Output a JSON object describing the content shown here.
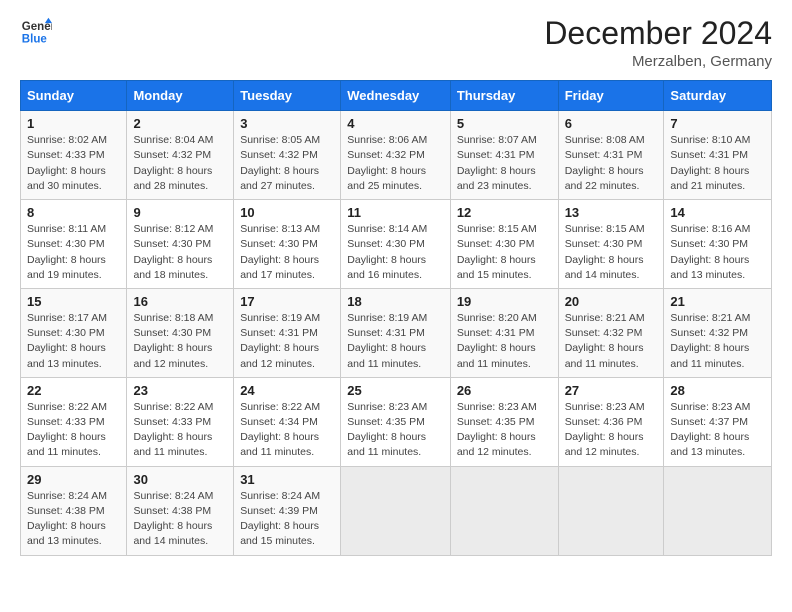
{
  "header": {
    "logo_line1": "General",
    "logo_line2": "Blue",
    "month": "December 2024",
    "location": "Merzalben, Germany"
  },
  "weekdays": [
    "Sunday",
    "Monday",
    "Tuesday",
    "Wednesday",
    "Thursday",
    "Friday",
    "Saturday"
  ],
  "weeks": [
    [
      {
        "day": "1",
        "sunrise": "8:02 AM",
        "sunset": "4:33 PM",
        "daylight": "8 hours and 30 minutes."
      },
      {
        "day": "2",
        "sunrise": "8:04 AM",
        "sunset": "4:32 PM",
        "daylight": "8 hours and 28 minutes."
      },
      {
        "day": "3",
        "sunrise": "8:05 AM",
        "sunset": "4:32 PM",
        "daylight": "8 hours and 27 minutes."
      },
      {
        "day": "4",
        "sunrise": "8:06 AM",
        "sunset": "4:32 PM",
        "daylight": "8 hours and 25 minutes."
      },
      {
        "day": "5",
        "sunrise": "8:07 AM",
        "sunset": "4:31 PM",
        "daylight": "8 hours and 23 minutes."
      },
      {
        "day": "6",
        "sunrise": "8:08 AM",
        "sunset": "4:31 PM",
        "daylight": "8 hours and 22 minutes."
      },
      {
        "day": "7",
        "sunrise": "8:10 AM",
        "sunset": "4:31 PM",
        "daylight": "8 hours and 21 minutes."
      }
    ],
    [
      {
        "day": "8",
        "sunrise": "8:11 AM",
        "sunset": "4:30 PM",
        "daylight": "8 hours and 19 minutes."
      },
      {
        "day": "9",
        "sunrise": "8:12 AM",
        "sunset": "4:30 PM",
        "daylight": "8 hours and 18 minutes."
      },
      {
        "day": "10",
        "sunrise": "8:13 AM",
        "sunset": "4:30 PM",
        "daylight": "8 hours and 17 minutes."
      },
      {
        "day": "11",
        "sunrise": "8:14 AM",
        "sunset": "4:30 PM",
        "daylight": "8 hours and 16 minutes."
      },
      {
        "day": "12",
        "sunrise": "8:15 AM",
        "sunset": "4:30 PM",
        "daylight": "8 hours and 15 minutes."
      },
      {
        "day": "13",
        "sunrise": "8:15 AM",
        "sunset": "4:30 PM",
        "daylight": "8 hours and 14 minutes."
      },
      {
        "day": "14",
        "sunrise": "8:16 AM",
        "sunset": "4:30 PM",
        "daylight": "8 hours and 13 minutes."
      }
    ],
    [
      {
        "day": "15",
        "sunrise": "8:17 AM",
        "sunset": "4:30 PM",
        "daylight": "8 hours and 13 minutes."
      },
      {
        "day": "16",
        "sunrise": "8:18 AM",
        "sunset": "4:30 PM",
        "daylight": "8 hours and 12 minutes."
      },
      {
        "day": "17",
        "sunrise": "8:19 AM",
        "sunset": "4:31 PM",
        "daylight": "8 hours and 12 minutes."
      },
      {
        "day": "18",
        "sunrise": "8:19 AM",
        "sunset": "4:31 PM",
        "daylight": "8 hours and 11 minutes."
      },
      {
        "day": "19",
        "sunrise": "8:20 AM",
        "sunset": "4:31 PM",
        "daylight": "8 hours and 11 minutes."
      },
      {
        "day": "20",
        "sunrise": "8:21 AM",
        "sunset": "4:32 PM",
        "daylight": "8 hours and 11 minutes."
      },
      {
        "day": "21",
        "sunrise": "8:21 AM",
        "sunset": "4:32 PM",
        "daylight": "8 hours and 11 minutes."
      }
    ],
    [
      {
        "day": "22",
        "sunrise": "8:22 AM",
        "sunset": "4:33 PM",
        "daylight": "8 hours and 11 minutes."
      },
      {
        "day": "23",
        "sunrise": "8:22 AM",
        "sunset": "4:33 PM",
        "daylight": "8 hours and 11 minutes."
      },
      {
        "day": "24",
        "sunrise": "8:22 AM",
        "sunset": "4:34 PM",
        "daylight": "8 hours and 11 minutes."
      },
      {
        "day": "25",
        "sunrise": "8:23 AM",
        "sunset": "4:35 PM",
        "daylight": "8 hours and 11 minutes."
      },
      {
        "day": "26",
        "sunrise": "8:23 AM",
        "sunset": "4:35 PM",
        "daylight": "8 hours and 12 minutes."
      },
      {
        "day": "27",
        "sunrise": "8:23 AM",
        "sunset": "4:36 PM",
        "daylight": "8 hours and 12 minutes."
      },
      {
        "day": "28",
        "sunrise": "8:23 AM",
        "sunset": "4:37 PM",
        "daylight": "8 hours and 13 minutes."
      }
    ],
    [
      {
        "day": "29",
        "sunrise": "8:24 AM",
        "sunset": "4:38 PM",
        "daylight": "8 hours and 13 minutes."
      },
      {
        "day": "30",
        "sunrise": "8:24 AM",
        "sunset": "4:38 PM",
        "daylight": "8 hours and 14 minutes."
      },
      {
        "day": "31",
        "sunrise": "8:24 AM",
        "sunset": "4:39 PM",
        "daylight": "8 hours and 15 minutes."
      },
      null,
      null,
      null,
      null
    ]
  ]
}
